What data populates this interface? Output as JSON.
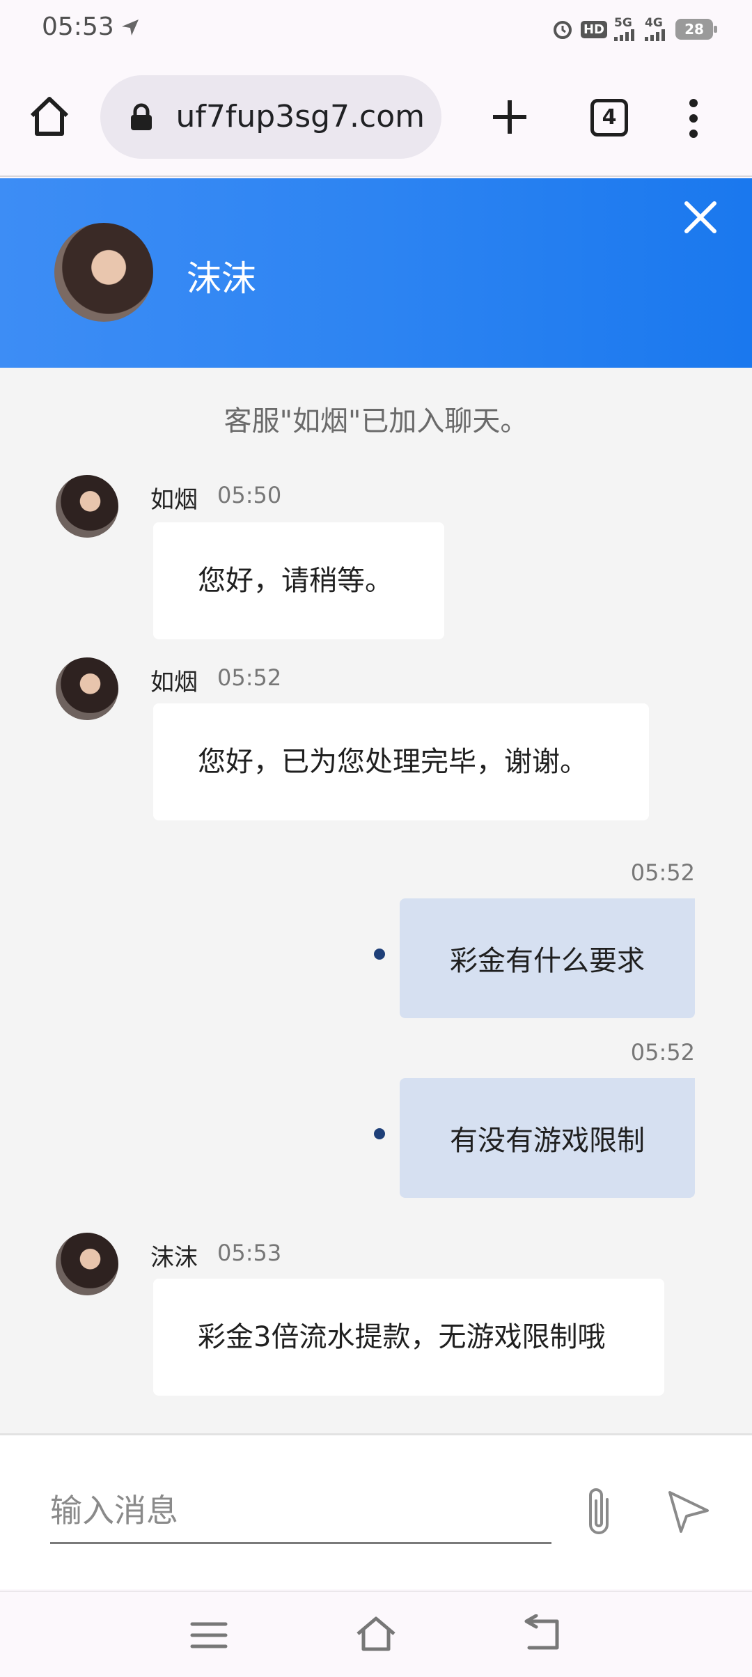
{
  "status_bar": {
    "time": "05:53",
    "hd_label": "HD",
    "net_5g": "5G",
    "net_4g": "4G",
    "battery": "28"
  },
  "browser": {
    "url": "uf7fup3sg7.com",
    "tab_count": "4"
  },
  "chat": {
    "agent_name": "沫沫",
    "system_message": "客服\"如烟\"已加入聊天。",
    "messages": [
      {
        "sender": "如烟",
        "time": "05:50",
        "text": "您好，请稍等。"
      },
      {
        "sender": "如烟",
        "time": "05:52",
        "text": "您好，已为您处理完毕，谢谢。"
      },
      {
        "sender": "me",
        "time": "05:52",
        "text": "彩金有什么要求"
      },
      {
        "sender": "me",
        "time": "05:52",
        "text": "有没有游戏限制"
      },
      {
        "sender": "沫沫",
        "time": "05:53",
        "text": "彩金3倍流水提款，无游戏限制哦"
      }
    ]
  },
  "input": {
    "placeholder": "输入消息"
  },
  "colors": {
    "header_blue": "#2d84f2",
    "outgoing_bubble": "#d6e0f1",
    "read_dot": "#1e3f78"
  },
  "icons": [
    "navigation-icon",
    "home-icon",
    "lock-icon",
    "plus-icon",
    "tabs-icon",
    "more-icon",
    "close-icon",
    "paperclip-icon",
    "send-icon",
    "menu-icon",
    "back-icon"
  ]
}
